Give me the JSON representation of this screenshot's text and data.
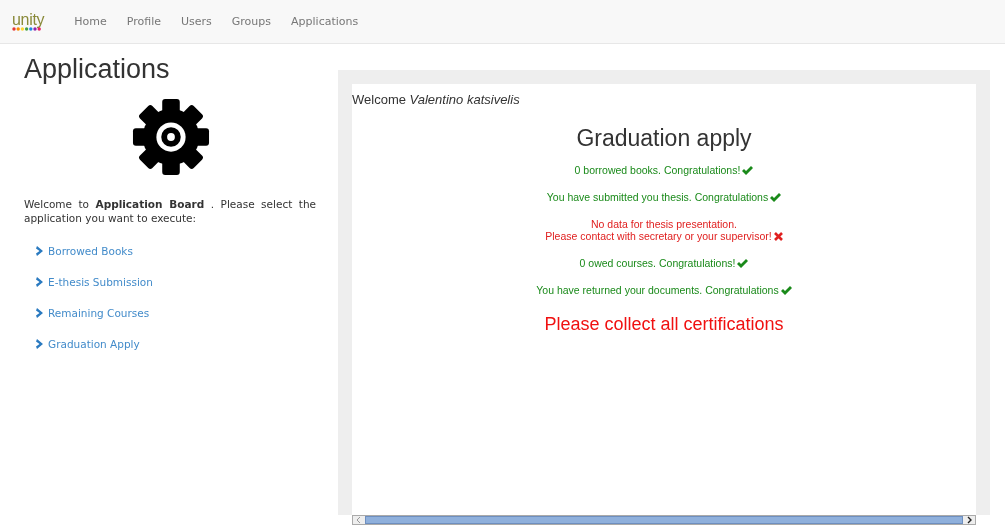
{
  "navbar": {
    "logo": "unity",
    "items": [
      {
        "label": "Home",
        "selected": false
      },
      {
        "label": "Profile",
        "selected": false
      },
      {
        "label": "Users",
        "selected": false
      },
      {
        "label": "Groups",
        "selected": false
      },
      {
        "label": "Applications",
        "selected": false
      }
    ]
  },
  "page_title": "Applications",
  "intro": "Welcome to **Application Board** . Please select the application you want to execute:",
  "apps": [
    "Borrowed Books",
    "E-thesis Submission",
    "Remaining Courses",
    "Graduation Apply"
  ],
  "frame": {
    "welcome": "Welcome",
    "user": "Valentino katsivelis",
    "title": "Graduation apply",
    "checks": [
      {
        "kind": "ok",
        "lines": [
          "0 borrowed books. Congratulations!"
        ]
      },
      {
        "kind": "ok",
        "lines": [
          "You have submitted you thesis. Congratulations"
        ]
      },
      {
        "kind": "fail",
        "lines": [
          "No data for thesis presentation.",
          "Please contact with secretary or your supervisor!"
        ]
      },
      {
        "kind": "ok",
        "lines": [
          "0 owed courses. Congratulations!"
        ]
      },
      {
        "kind": "ok",
        "lines": [
          "You have returned your documents. Congratulations"
        ]
      }
    ],
    "result": "Please collect all certifications"
  }
}
